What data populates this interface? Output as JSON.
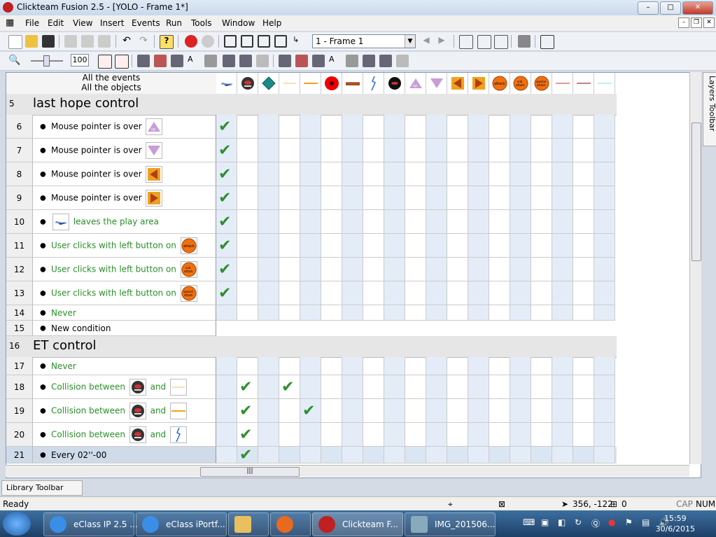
{
  "window": {
    "title": "Clickteam Fusion 2.5 - [YOLO - Frame 1*]",
    "minimize": "–",
    "maximize": "□",
    "close": "✕"
  },
  "menu": [
    "File",
    "Edit",
    "View",
    "Insert",
    "Events",
    "Run",
    "Tools",
    "Window",
    "Help"
  ],
  "frame_selector": {
    "value": "1 - Frame 1"
  },
  "zoom": {
    "value": "100"
  },
  "header": {
    "line1": "All the events",
    "line2": "All the objects"
  },
  "groups": [
    {
      "num": "5",
      "name": "last hope control"
    },
    {
      "num": "16",
      "name": "ET control"
    }
  ],
  "rows": [
    {
      "num": "6",
      "text": "Mouse pointer is over",
      "green": false,
      "icon": "up-triangle"
    },
    {
      "num": "7",
      "text": "Mouse pointer is over",
      "green": false,
      "icon": "down-triangle"
    },
    {
      "num": "8",
      "text": "Mouse pointer is over",
      "green": false,
      "icon": "left-arrow"
    },
    {
      "num": "9",
      "text": "Mouse pointer is over",
      "green": false,
      "icon": "right-arrow"
    },
    {
      "num": "10",
      "text": "leaves the play area",
      "green": true,
      "icon": "ship"
    },
    {
      "num": "11",
      "text": "User clicks with left button on",
      "green": true,
      "icon": "attack-button"
    },
    {
      "num": "12",
      "text": "User clicks with left button on",
      "green": true,
      "icon": "sub-attack-button"
    },
    {
      "num": "13",
      "text": "User clicks with left button on",
      "green": true,
      "icon": "special-attack-button"
    },
    {
      "num": "14",
      "text": "Never",
      "green": true
    },
    {
      "num": "15",
      "text": "New condition",
      "green": false
    },
    {
      "num": "17",
      "text": "Never",
      "green": true
    },
    {
      "num": "18",
      "text": "Collision between",
      "green": true,
      "and": "and"
    },
    {
      "num": "19",
      "text": "Collision between",
      "green": true,
      "and": "and"
    },
    {
      "num": "20",
      "text": "Collision between",
      "green": true,
      "and": "and"
    },
    {
      "num": "21",
      "text": "Every 02''-00",
      "green": false
    }
  ],
  "object_icons": [
    "ship",
    "enemy-face",
    "diamond",
    "thin-line",
    "orange-line",
    "red-ball",
    "brown-bar",
    "lightning",
    "black-face",
    "up-triangle",
    "down-triangle",
    "left-arrow",
    "right-arrow",
    "attack-button",
    "sub-attack-button",
    "special-attack-button",
    "red-line",
    "dark-red-line",
    "teal-line"
  ],
  "checkmark": "✔",
  "sidepanel": {
    "layers": "Layers Toolbar",
    "library": "Library Toolbar"
  },
  "status": {
    "ready": "Ready",
    "coords": "356, -122",
    "sel": "0",
    "cap": "CAP",
    "num": "NUM"
  },
  "taskbar": {
    "tasks": [
      "eClass IP 2.5 ...",
      "eClass iPortf...",
      "Clickteam F...",
      "IMG_201506..."
    ],
    "time": "15:59",
    "date": "30/6/2015"
  },
  "colors": {
    "accent": "#2f8f2f",
    "green_text": "#2a8f2a",
    "shade": "#e4ecf7"
  }
}
